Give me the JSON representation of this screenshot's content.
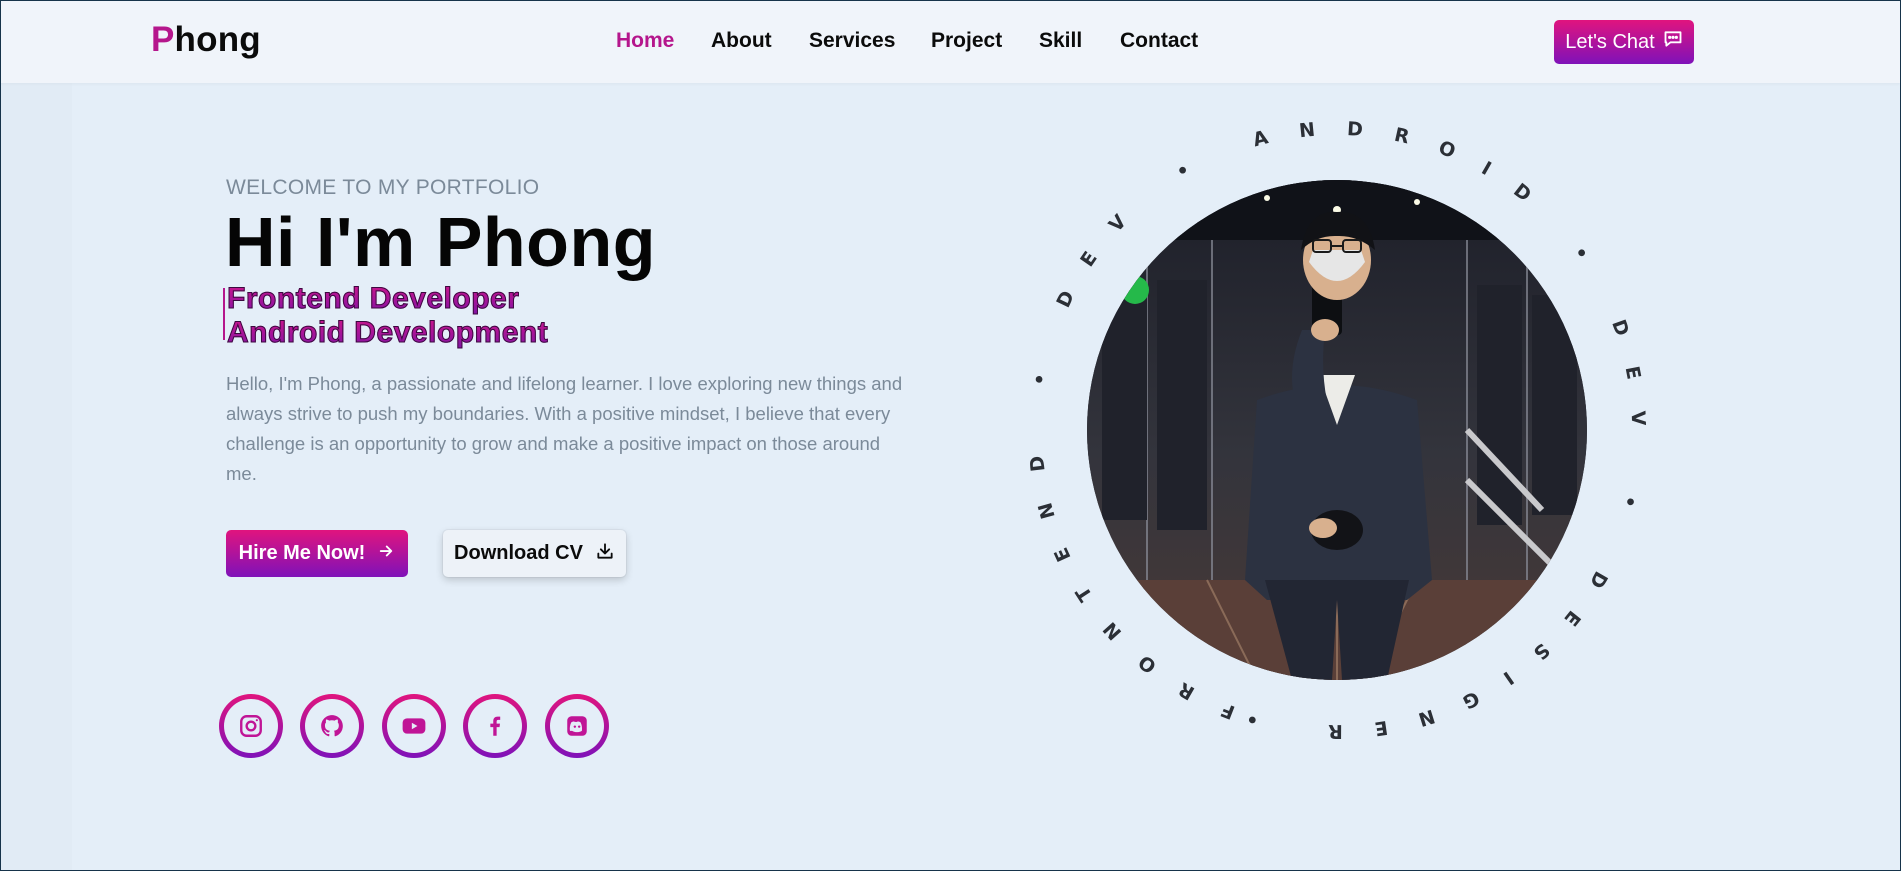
{
  "nav": {
    "logo_first": "P",
    "logo_rest": "hong",
    "links": [
      {
        "label": "Home",
        "active": true
      },
      {
        "label": "About",
        "active": false
      },
      {
        "label": "Services",
        "active": false
      },
      {
        "label": "Project",
        "active": false
      },
      {
        "label": "Skill",
        "active": false
      },
      {
        "label": "Contact",
        "active": false
      }
    ],
    "chat_label": "Let's Chat",
    "chat_icon": "chat-icon"
  },
  "hero": {
    "welcome": "WELCOME TO MY PORTFOLIO",
    "title": "Hi I'm Phong",
    "roles": [
      "Frontend Developer",
      "Android Development"
    ],
    "bio": "Hello, I'm Phong, a passionate and lifelong learner. I love exploring new things and always strive to push my boundaries. With a positive mindset, I believe that every challenge is an opportunity to grow and make a positive impact on those around me.",
    "hire_label": "Hire Me Now!",
    "hire_icon": "arrow-right-icon",
    "cv_label": "Download CV",
    "cv_icon": "download-icon"
  },
  "social": [
    {
      "name": "instagram",
      "icon": "instagram-icon"
    },
    {
      "name": "github",
      "icon": "github-icon"
    },
    {
      "name": "youtube",
      "icon": "youtube-icon"
    },
    {
      "name": "facebook",
      "icon": "facebook-icon"
    },
    {
      "name": "discord",
      "icon": "discord-icon"
    }
  ],
  "ring_text": "FRONTEND • DEV • ANDROID • DEV • DESIGNER • ",
  "colors": {
    "accent": "#b5168c",
    "gradient_start": "#e0147e",
    "gradient_end": "#7f12b9",
    "background": "#e4eef8",
    "navbar": "#f0f4fa",
    "muted_text": "#7b8a99"
  }
}
